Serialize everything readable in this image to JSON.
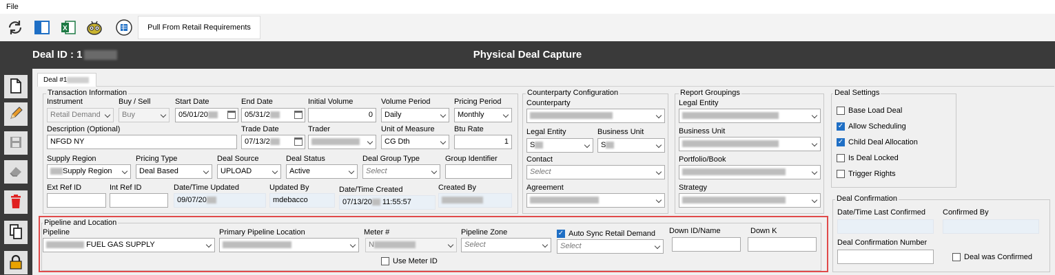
{
  "menu": {
    "file": "File"
  },
  "toolbar": {
    "pull_label": "Pull From Retail Requirements"
  },
  "header": {
    "deal_id_label": "Deal ID : 1",
    "title": "Physical Deal Capture"
  },
  "tab": {
    "label": "Deal #1"
  },
  "transaction": {
    "legend": "Transaction Information",
    "instrument_label": "Instrument",
    "instrument_value": "Retail Demand",
    "buysell_label": "Buy / Sell",
    "buysell_value": "Buy",
    "start_label": "Start Date",
    "start_value": "05/01/20",
    "end_label": "End Date",
    "end_value": "05/31/2",
    "init_vol_label": "Initial Volume",
    "init_vol_value": "0",
    "vol_period_label": "Volume Period",
    "vol_period_value": "Daily",
    "pricing_period_label": "Pricing Period",
    "pricing_period_value": "Monthly",
    "desc_label": "Description (Optional)",
    "desc_value": "NFGD NY",
    "trade_date_label": "Trade Date",
    "trade_date_value": "07/13/2",
    "trader_label": "Trader",
    "uom_label": "Unit of Measure",
    "uom_value": "CG Dth",
    "btu_label": "Btu Rate",
    "btu_value": "1",
    "supply_label": "Supply Region",
    "supply_value": "Supply Region",
    "pricing_type_label": "Pricing Type",
    "pricing_type_value": "Deal Based",
    "deal_source_label": "Deal Source",
    "deal_source_value": "UPLOAD",
    "deal_status_label": "Deal Status",
    "deal_status_value": "Active",
    "deal_group_label": "Deal Group Type",
    "deal_group_placeholder": "Select",
    "group_id_label": "Group Identifier",
    "ext_ref_label": "Ext Ref ID",
    "int_ref_label": "Int Ref ID",
    "updated_label": "Date/Time Updated",
    "updated_value": "09/07/20",
    "updated_by_label": "Updated By",
    "updated_by_value": "mdebacco",
    "created_label": "Date/Time Created",
    "created_value": "07/13/20",
    "created_time": "11:55:57",
    "created_by_label": "Created By"
  },
  "counterparty": {
    "legend": "Counterparty Configuration",
    "counterparty_label": "Counterparty",
    "legal_entity_label": "Legal Entity",
    "legal_entity_value": "S",
    "business_unit_label": "Business Unit",
    "business_unit_value": "S",
    "contact_label": "Contact",
    "contact_placeholder": "Select",
    "agreement_label": "Agreement"
  },
  "report": {
    "legend": "Report Groupings",
    "legal_entity_label": "Legal Entity",
    "business_unit_label": "Business Unit",
    "portfolio_label": "Portfolio/Book",
    "strategy_label": "Strategy"
  },
  "settings": {
    "legend": "Deal Settings",
    "items": [
      {
        "label": "Base Load Deal",
        "checked": false
      },
      {
        "label": "Allow Scheduling",
        "checked": true
      },
      {
        "label": "Child Deal Allocation",
        "checked": true
      },
      {
        "label": "Is Deal Locked",
        "checked": false
      },
      {
        "label": "Trigger Rights",
        "checked": false
      }
    ]
  },
  "confirmation": {
    "legend": "Deal Confirmation",
    "last_confirmed_label": "Date/Time Last Confirmed",
    "confirmed_by_label": "Confirmed By",
    "number_label": "Deal Confirmation Number",
    "was_confirmed_label": "Deal was Confirmed"
  },
  "pipeline": {
    "legend": "Pipeline and Location",
    "pipeline_label": "Pipeline",
    "pipeline_value": "FUEL GAS SUPPLY",
    "primary_loc_label": "Primary Pipeline Location",
    "meter_label": "Meter #",
    "meter_value": "N",
    "zone_label": "Pipeline  Zone",
    "zone_placeholder": "Select",
    "auto_sync_label": "Auto Sync Retail Demand",
    "auto_sync_placeholder": "Select",
    "down_id_label": "Down ID/Name",
    "down_k_label": "Down K",
    "use_meter_label": "Use Meter ID"
  },
  "colors": {
    "header_bg": "#3a3a3a",
    "accent": "#1f6fc5",
    "highlight": "#e04a4a"
  }
}
